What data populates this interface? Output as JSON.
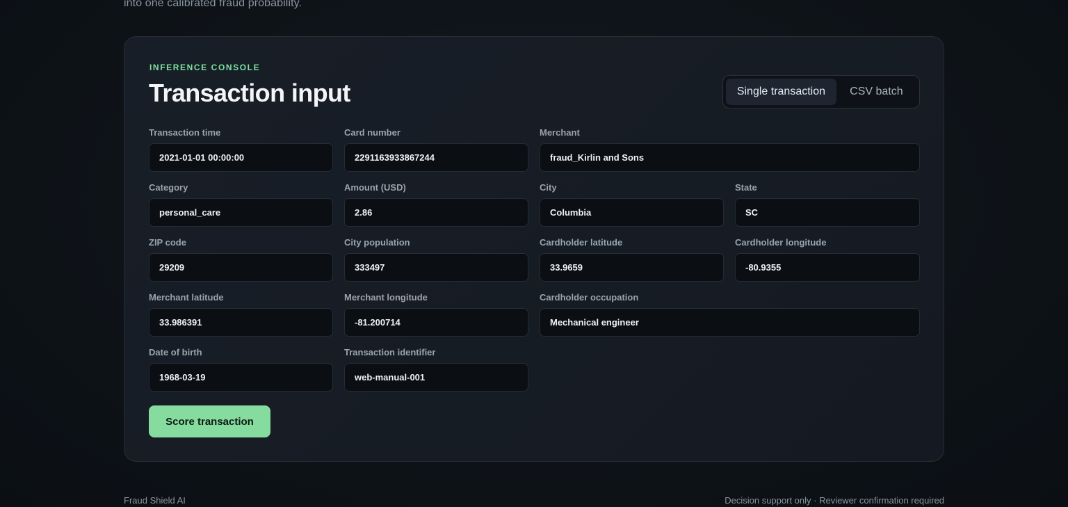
{
  "intro_text": "into one calibrated fraud probability.",
  "console": {
    "eyebrow": "INFERENCE CONSOLE",
    "title": "Transaction input",
    "mode_tabs": [
      "Single transaction",
      "CSV batch"
    ],
    "active_tab": "Single transaction"
  },
  "fields": {
    "transaction_time": {
      "label": "Transaction time",
      "value": "2021-01-01 00:00:00"
    },
    "card_number": {
      "label": "Card number",
      "value": "2291163933867244"
    },
    "merchant": {
      "label": "Merchant",
      "value": "fraud_Kirlin and Sons"
    },
    "category": {
      "label": "Category",
      "value": "personal_care"
    },
    "amount": {
      "label": "Amount (USD)",
      "value": "2.86"
    },
    "city": {
      "label": "City",
      "value": "Columbia"
    },
    "state": {
      "label": "State",
      "value": "SC"
    },
    "zip": {
      "label": "ZIP code",
      "value": "29209"
    },
    "city_pop": {
      "label": "City population",
      "value": "333497"
    },
    "card_lat": {
      "label": "Cardholder latitude",
      "value": "33.9659"
    },
    "card_long": {
      "label": "Cardholder longitude",
      "value": "-80.9355"
    },
    "merch_lat": {
      "label": "Merchant latitude",
      "value": "33.986391"
    },
    "merch_long": {
      "label": "Merchant longitude",
      "value": "-81.200714"
    },
    "occupation": {
      "label": "Cardholder occupation",
      "value": "Mechanical engineer"
    },
    "dob": {
      "label": "Date of birth",
      "value": "1968-03-19"
    },
    "txn_id": {
      "label": "Transaction identifier",
      "value": "web-manual-001"
    }
  },
  "actions": {
    "score_label": "Score transaction"
  },
  "footer": {
    "brand": "Fraud Shield AI",
    "disclaimer": "Decision support only · Reviewer confirmation required"
  },
  "colors": {
    "accent": "#86dc9e",
    "eyebrow": "#7ee2a0",
    "background": "#0d1117"
  }
}
